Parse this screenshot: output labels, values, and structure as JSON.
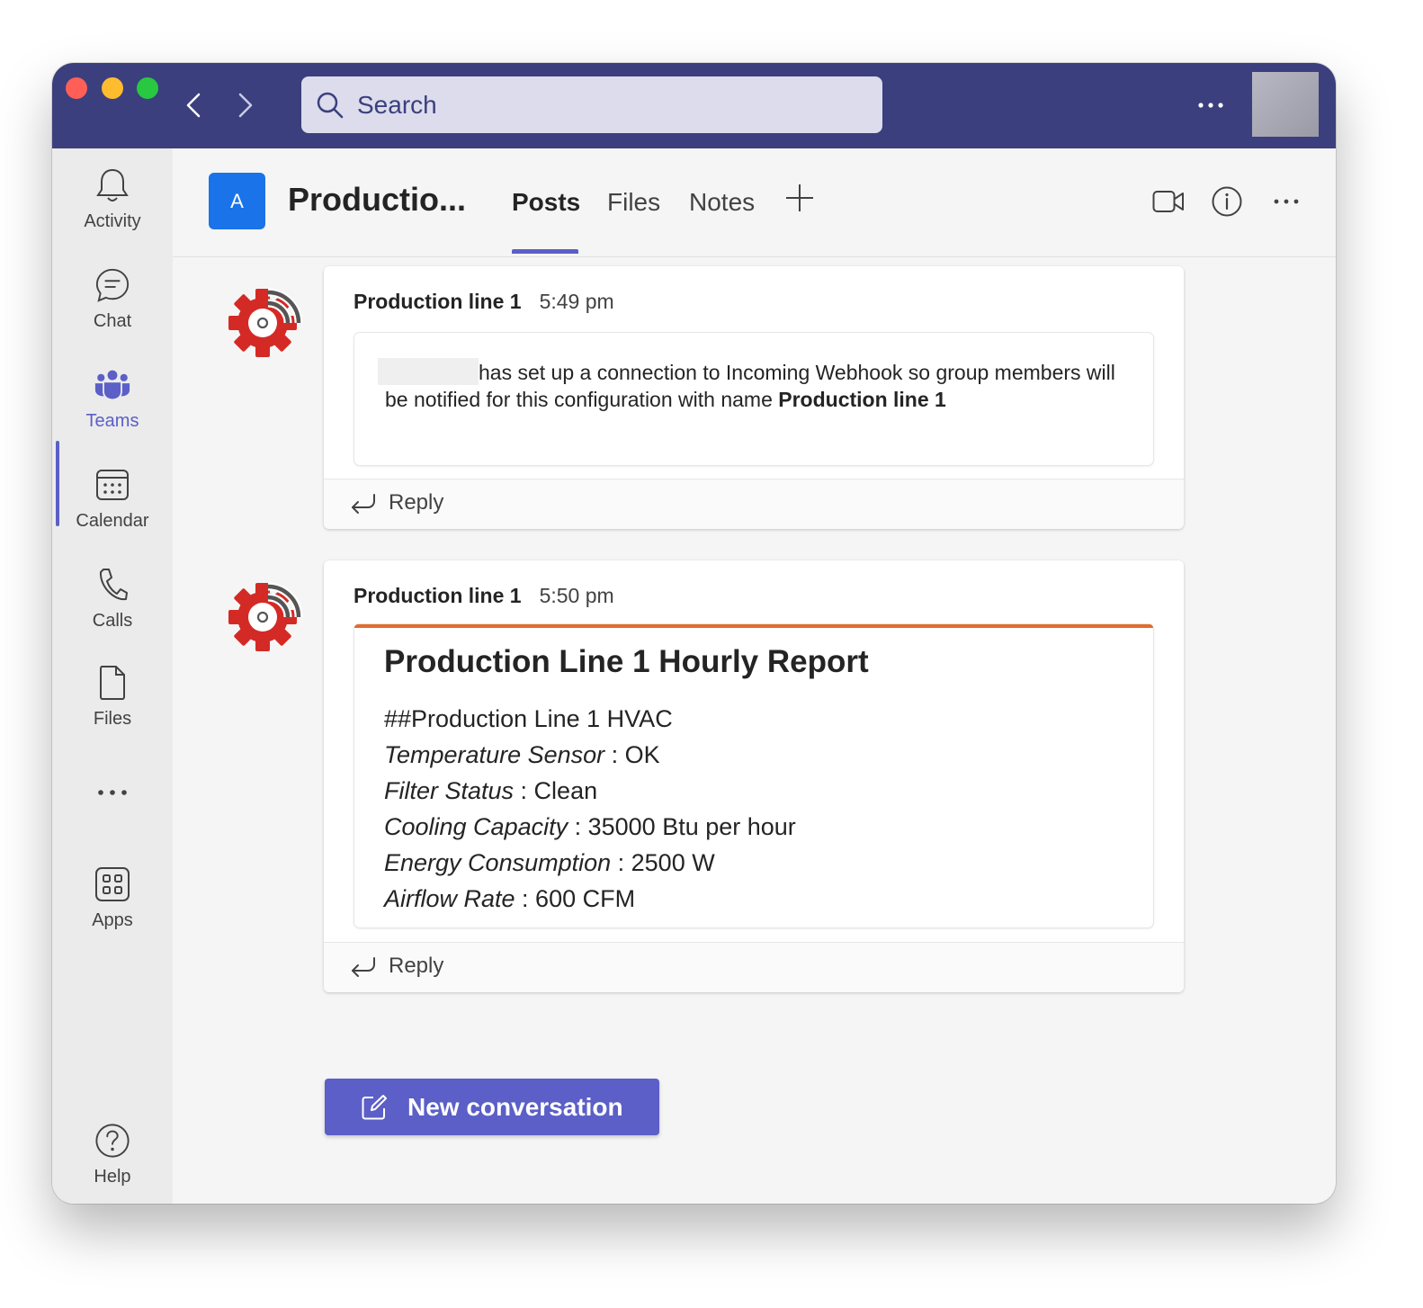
{
  "titlebar": {
    "search_placeholder": "Search",
    "more_label": "..."
  },
  "rail": {
    "items": [
      {
        "label": "Activity",
        "icon": "bell-icon"
      },
      {
        "label": "Chat",
        "icon": "chat-icon"
      },
      {
        "label": "Teams",
        "icon": "teams-icon"
      },
      {
        "label": "Calendar",
        "icon": "calendar-icon"
      },
      {
        "label": "Calls",
        "icon": "phone-icon"
      },
      {
        "label": "Files",
        "icon": "file-icon"
      },
      {
        "label": "...",
        "icon": "more-icon"
      },
      {
        "label": "Apps",
        "icon": "apps-icon"
      },
      {
        "label": "Help",
        "icon": "help-icon"
      }
    ],
    "active": "Teams"
  },
  "header": {
    "team_initial": "A",
    "team_name": "Productio...",
    "tabs": [
      {
        "label": "Posts",
        "active": true
      },
      {
        "label": "Files",
        "active": false
      },
      {
        "label": "Notes",
        "active": false
      }
    ],
    "more_label": "..."
  },
  "messages": [
    {
      "sender": "Production line 1",
      "time": "5:49 pm",
      "body_pre": "has set up a connection to Incoming Webhook so group members will be notified for this configuration with name ",
      "body_bold": "Production line 1",
      "reply_label": "Reply"
    },
    {
      "sender": "Production line 1",
      "time": "5:50 pm",
      "report_title": "Production Line 1 Hourly Report",
      "report_heading": "##Production Line 1 HVAC",
      "report_rows": [
        {
          "key": "Temperature Sensor",
          "value": " : OK"
        },
        {
          "key": "Filter Status",
          "value": " : Clean"
        },
        {
          "key": "Cooling Capacity",
          "value": " : 35000 Btu per hour"
        },
        {
          "key": "Energy Consumption",
          "value": " : 2500 W"
        },
        {
          "key": "Airflow Rate",
          "value": " : 600 CFM"
        }
      ],
      "accent_color": "#e06c2c",
      "reply_label": "Reply"
    }
  ],
  "new_conversation_label": "New conversation",
  "colors": {
    "titlebar": "#3b3f7d",
    "brand": "#5b5fc7",
    "team_avatar": "#1a73e8",
    "bot_red": "#d42a26"
  }
}
